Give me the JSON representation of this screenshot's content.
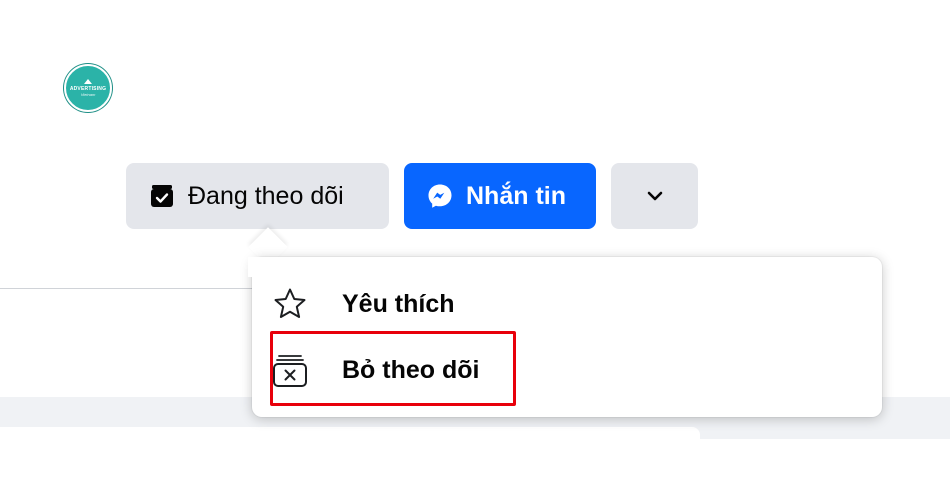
{
  "logo": {
    "line1": "ADVERTISING",
    "line2": "Vietnam"
  },
  "actions": {
    "following_label": "Đang theo dõi",
    "message_label": "Nhắn tin",
    "more_icon": "chevron-down-icon"
  },
  "menu": {
    "items": [
      {
        "label": "Yêu thích",
        "icon": "star-icon"
      },
      {
        "label": "Bỏ theo dõi",
        "icon": "unfollow-icon"
      }
    ]
  },
  "colors": {
    "primary": "#0866ff",
    "secondary_button": "#e4e6eb",
    "highlight": "#e8000b"
  }
}
